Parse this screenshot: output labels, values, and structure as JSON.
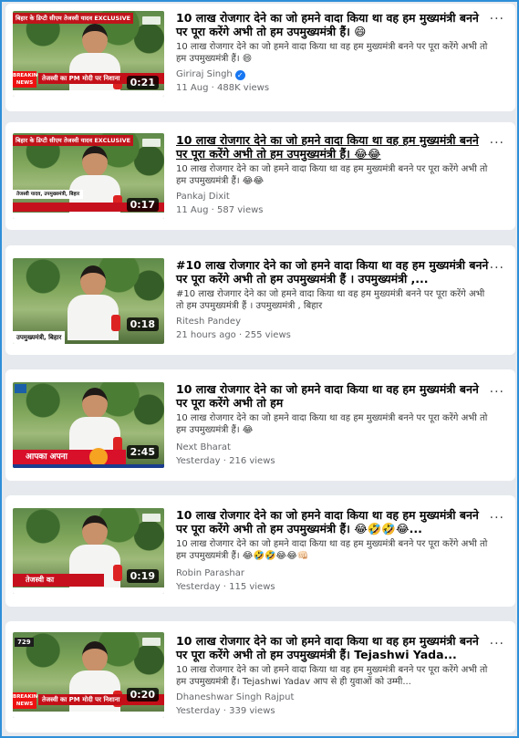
{
  "results": [
    {
      "title": "10 लाख रोजगार देने का जो हमने वादा किया था वह हम मुख्यमंत्री बनने पर पूरा करेंगे अभी तो हम उपमुख्यमंत्री हैं। 😄",
      "description": "10 लाख रोजगार देने का जो हमने वादा किया था वह हम मुख्यमंत्री बनने पर पूरा करेंगे अभी तो हम उपमुख्यमंत्री हैं। 😄",
      "author": "Giriraj Singh",
      "verified": true,
      "date": "11 Aug",
      "views": "488K views",
      "duration": "0:21",
      "thumb_top": "बिहार के डिप्टी सीएम तेजस्वी यादव EXCLUSIVE",
      "thumb_breaking": "BREAKING NEWS",
      "thumb_ticker": "तेजस्वी का PM मोदी पर निशाना"
    },
    {
      "title": "10 लाख रोजगार देने का जो हमने वादा किया था वह हम मुख्यमंत्री बनने पर पूरा करेंगे अभी तो हम उपमुख्यमंत्री हैं। 😂😂",
      "description": "10 लाख रोजगार देने का जो हमने वादा किया था वह हम मुख्यमंत्री बनने पर पूरा करेंगे अभी तो हम उपमुख्यमंत्री हैं। 😂😂",
      "author": "Pankaj Dixit",
      "date": "11 Aug",
      "views": "587 views",
      "duration": "0:17",
      "thumb_top": "बिहार के डिप्टी सीएम तेजस्वी यादव EXCLUSIVE",
      "thumb_caption": "तेजस्वी यादव, उपमुख्यमंत्री, बिहार"
    },
    {
      "title": "#10 लाख रोजगार देने का जो हमने वादा किया था वह हम मुख्यमंत्री बनने पर पूरा करेंगे अभी तो हम उपमुख्यमंत्री हैं । उपमुख्यमंत्री ,...",
      "description": "#10 लाख रोजगार देने का जो हमने वादा किया था वह हम मुख्यमंत्री बनने पर पूरा करेंगे अभी तो हम उपमुख्यमंत्री हैं । उपमुख्यमंत्री , बिहार",
      "author": "Ritesh Pandey",
      "date": "21 hours ago",
      "views": "255 views",
      "duration": "0:18",
      "thumb_caption": "उपमुख्यमंत्री, बिहार"
    },
    {
      "title": "10 लाख रोजगार देने का जो हमने वादा किया था वह हम मुख्यमंत्री बनने पर पूरा करेंगे अभी तो हम",
      "description": "10 लाख रोजगार देने का जो हमने वादा किया था वह हम मुख्यमंत्री बनने पर पूरा करेंगे अभी तो हम उपमुख्यमंत्री हैं। 😂",
      "author": "Next Bharat",
      "date": "Yesterday",
      "views": "216 views",
      "duration": "2:45",
      "thumb_bar": "आपका अपना"
    },
    {
      "title": "10 लाख रोजगार देने का जो हमने वादा किया था वह हम मुख्यमंत्री बनने पर पूरा करेंगे अभी तो हम उपमुख्यमंत्री हैं। 😂🤣🤣😂...",
      "description": "10 लाख रोजगार देने का जो हमने वादा किया था वह हम मुख्यमंत्री बनने पर पूरा करेंगे अभी तो हम उपमुख्यमंत्री हैं। 😂🤣🤣😂😂👊🏻",
      "author": "Robin Parashar",
      "date": "Yesterday",
      "views": "115 views",
      "duration": "0:19",
      "thumb_bar": "तेजस्वी का"
    },
    {
      "title": "10 लाख रोजगार देने का जो हमने वादा किया था वह हम मुख्यमंत्री बनने पर पूरा करेंगे अभी तो हम उपमुख्यमंत्री हैं। Tejashwi Yada...",
      "description": "10 लाख रोजगार देने का जो हमने वादा किया था वह हम मुख्यमंत्री बनने पर पूरा करेंगे अभी तो हम उपमुख्यमंत्री हैं। Tejashwi Yadav आप से ही युवाओं को उम्मी...",
      "author": "Dhaneshwar Singh Rajput",
      "date": "Yesterday",
      "views": "339 views",
      "duration": "0:20",
      "thumb_badge": "729",
      "thumb_breaking": "BREAKING NEWS",
      "thumb_ticker": "तेजस्वी का PM मोदी पर निशाना"
    }
  ],
  "meta_sep": " · ",
  "more_label": "···",
  "colors": {
    "frame": "#2f8fd8",
    "link_gray": "#65676b",
    "verified": "#1877f2"
  },
  "icons": {
    "more": "more-options-icon",
    "verified": "verified-badge-icon"
  }
}
